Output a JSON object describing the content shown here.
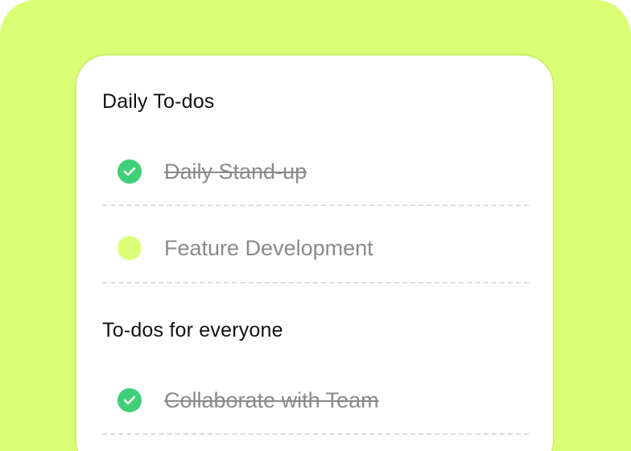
{
  "sections": [
    {
      "title": "Daily To-dos",
      "items": [
        {
          "label": "Daily Stand-up",
          "done": true,
          "status_icon": "check-circle-icon"
        },
        {
          "label": "Feature Development",
          "done": false,
          "status_icon": "circle-icon"
        }
      ]
    },
    {
      "title": "To-dos for everyone",
      "items": [
        {
          "label": "Collaborate with Team",
          "done": true,
          "status_icon": "check-circle-icon"
        }
      ]
    }
  ],
  "colors": {
    "background": "#daff77",
    "card": "#ffffff",
    "done": "#3fcf79",
    "pending": "#daff77",
    "muted_text": "#8a8a8a",
    "title_text": "#111111"
  }
}
